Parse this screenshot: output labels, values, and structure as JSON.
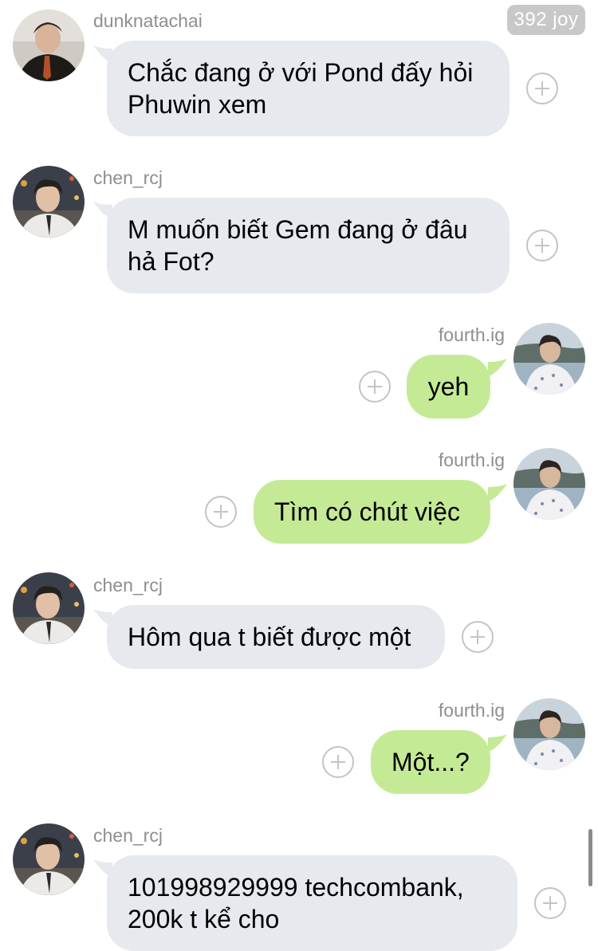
{
  "header": {
    "badge": "392 joy"
  },
  "messages": [
    {
      "sender": "dunknatachai",
      "direction": "incoming",
      "lines": [
        "Chắc đang ở với Pond đấy hỏi",
        "Phuwin xem"
      ]
    },
    {
      "sender": "chen_rcj",
      "direction": "incoming",
      "lines": [
        "M muốn biết Gem đang ở đâu",
        "hả Fot?"
      ]
    },
    {
      "sender": "fourth.ig",
      "direction": "outgoing",
      "lines": [
        "yeh"
      ]
    },
    {
      "sender": "fourth.ig",
      "direction": "outgoing",
      "lines": [
        "Tìm có chút việc"
      ]
    },
    {
      "sender": "chen_rcj",
      "direction": "incoming",
      "lines": [
        "Hôm qua t biết được một"
      ]
    },
    {
      "sender": "fourth.ig",
      "direction": "outgoing",
      "lines": [
        "Một...?"
      ]
    },
    {
      "sender": "chen_rcj",
      "direction": "incoming",
      "lines": [
        "101998929999 techcombank,",
        "200k t kể cho"
      ]
    }
  ],
  "colors": {
    "incoming_bubble": "#e6e9ee",
    "outgoing_bubble": "#c5ea96",
    "name_text": "#8e8e93",
    "badge_bg": "#c8c8c8"
  },
  "icons": {
    "add_reaction": "plus-circle-icon"
  }
}
